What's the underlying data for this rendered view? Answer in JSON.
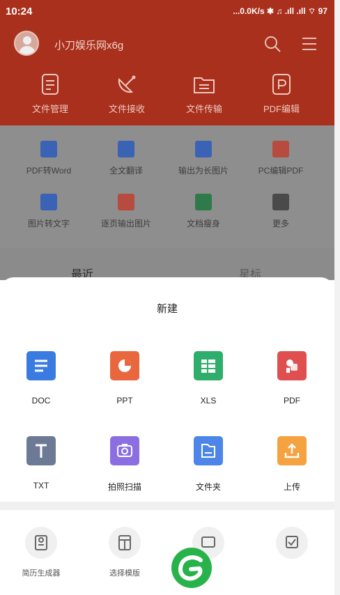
{
  "status": {
    "time": "10:24",
    "right": "...0.0K/s ✱ ♫ .ıll .ıll ⌔ 97"
  },
  "header": {
    "username": "小刀娱乐网x6g"
  },
  "tools": [
    {
      "label": "文件管理",
      "icon": "document-icon"
    },
    {
      "label": "文件接收",
      "icon": "satellite-icon"
    },
    {
      "label": "文件传输",
      "icon": "folder-transfer-icon"
    },
    {
      "label": "PDF编辑",
      "icon": "pdf-edit-icon"
    }
  ],
  "quick": [
    {
      "label": "PDF转Word",
      "color": "#3a63b6"
    },
    {
      "label": "全文翻译",
      "color": "#3a63b6"
    },
    {
      "label": "输出为长图片",
      "color": "#3a63b6"
    },
    {
      "label": "PC编辑PDF",
      "color": "#b84b3f"
    },
    {
      "label": "图片转文字",
      "color": "#3a63b6"
    },
    {
      "label": "逐页输出图片",
      "color": "#b84b3f"
    },
    {
      "label": "文档瘦身",
      "color": "#2e7a4a"
    },
    {
      "label": "更多",
      "color": "#4a4a4a"
    }
  ],
  "tabs": {
    "recent": "最近",
    "starred": "星标"
  },
  "sheet": {
    "title": "新建",
    "files": [
      {
        "label": "DOC",
        "color": "#3a7be2"
      },
      {
        "label": "PPT",
        "color": "#e8673f"
      },
      {
        "label": "XLS",
        "color": "#2fae6b"
      },
      {
        "label": "PDF",
        "color": "#e04f4f"
      },
      {
        "label": "TXT",
        "color": "#6d7a95"
      },
      {
        "label": "拍照扫描",
        "color": "#8b6fe0"
      },
      {
        "label": "文件夹",
        "color": "#4d86e8"
      },
      {
        "label": "上传",
        "color": "#f5a340"
      }
    ],
    "bottom": [
      {
        "label": "简历生成器"
      },
      {
        "label": "选择模版"
      },
      {
        "label": ""
      },
      {
        "label": ""
      }
    ]
  }
}
